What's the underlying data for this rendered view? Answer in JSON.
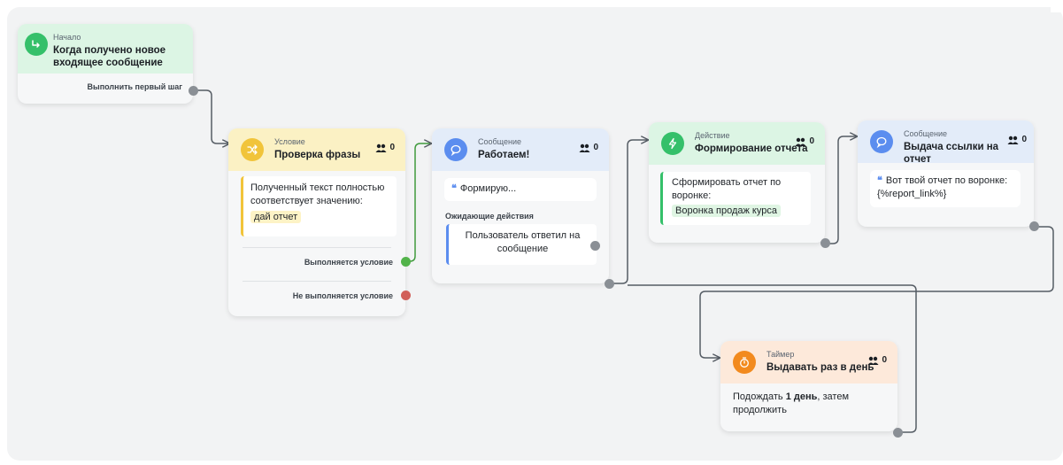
{
  "nodes": {
    "start": {
      "type": "Начало",
      "title": "Когда получено новое входящее сообщение",
      "footer": "Выполнить первый шаг",
      "color": "#dcf5e4",
      "badge_color": "#35c06a",
      "icon": "enter-arrow-icon"
    },
    "condition": {
      "type": "Условие",
      "title": "Проверка фразы",
      "count": "0",
      "rule_text": "Полученный текст полностью соответствует значению:",
      "value": "дай отчет",
      "true_label": "Выполняется условие",
      "false_label": "Не выполняется условие",
      "color": "#fbf1c4",
      "badge_color": "#f1c43a",
      "icon": "shuffle-icon"
    },
    "message1": {
      "type": "Сообщение",
      "title": "Работаем!",
      "count": "0",
      "message": "Формирую...",
      "pending_label": "Ожидающие действия",
      "pending_item": "Пользователь ответил на сообщение",
      "color": "#e3ecf9",
      "badge_color": "#5b8def",
      "icon": "chat-bubble-icon"
    },
    "action": {
      "type": "Действие",
      "title": "Формирование отчета",
      "count": "0",
      "text": "Сформировать отчет по воронке:",
      "value": "Воронка продаж курса",
      "color": "#dcf5e4",
      "badge_color": "#35c06a",
      "icon": "lightning-icon"
    },
    "message2": {
      "type": "Сообщение",
      "title": "Выдача ссылки на отчет",
      "count": "0",
      "message": "Вот твой отчет по воронке: {%report_link%}",
      "color": "#e3ecf9",
      "badge_color": "#5b8def",
      "icon": "chat-bubble-icon"
    },
    "timer": {
      "type": "Таймер",
      "title": "Выдавать раз в день",
      "count": "0",
      "text_before": "Подождать ",
      "text_bold": "1 день",
      "text_after": ", затем продолжить",
      "color": "#fde9da",
      "badge_color": "#f28a1e",
      "icon": "stopwatch-icon"
    }
  }
}
